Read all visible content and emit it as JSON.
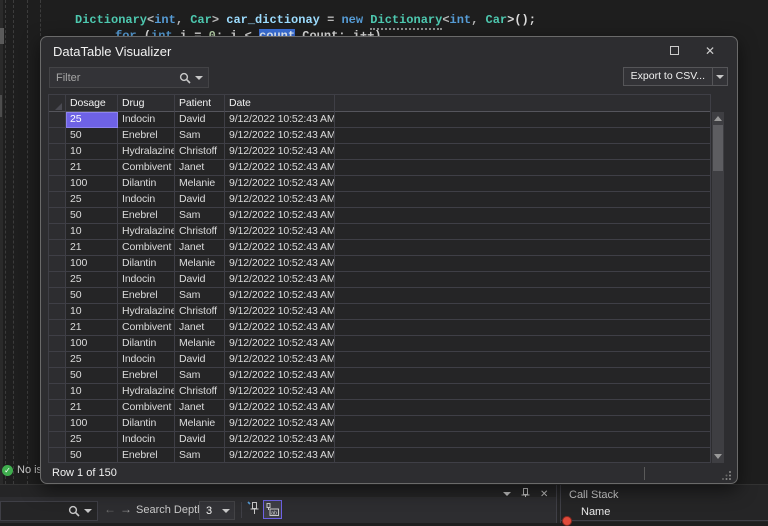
{
  "colors": {
    "editor_bg": "#1e1e1e",
    "dialog_bg": "#2d2d30",
    "grid_bg": "#252526",
    "gridline": "#3f3f46",
    "selected_cell": "#6e62e5",
    "selection_blue": "#3a6fd8",
    "type_teal": "#4EC9B0",
    "keyword_blue": "#569CD6",
    "variable_blue": "#9CDCFE",
    "success_green": "#3fae4e",
    "breakpoint_red": "#e04a3a",
    "toggle_accent": "#6e62e5"
  },
  "editor": {
    "code_line_1": [
      {
        "t": "Dictionary",
        "c": "type"
      },
      {
        "t": "<",
        "c": "op"
      },
      {
        "t": "int",
        "c": "kw"
      },
      {
        "t": ", ",
        "c": "op"
      },
      {
        "t": "Car",
        "c": "type"
      },
      {
        "t": "> ",
        "c": "op"
      },
      {
        "t": "car_dictionay",
        "c": "var"
      },
      {
        "t": " = ",
        "c": "op"
      },
      {
        "t": "new",
        "c": "kw"
      },
      {
        "t": " ",
        "c": "op"
      },
      {
        "t": "Dictionary",
        "c": "type",
        "dots": true
      },
      {
        "t": "<",
        "c": "op"
      },
      {
        "t": "int",
        "c": "kw"
      },
      {
        "t": ", ",
        "c": "op"
      },
      {
        "t": "Car",
        "c": "type"
      },
      {
        "t": ">();",
        "c": "plain"
      }
    ],
    "code_line_2": [
      {
        "t": "for",
        "c": "kw"
      },
      {
        "t": " (",
        "c": "plain"
      },
      {
        "t": "int",
        "c": "kw"
      },
      {
        "t": " i = ",
        "c": "plain"
      },
      {
        "t": "0",
        "c": "num"
      },
      {
        "t": "; i < ",
        "c": "plain"
      },
      {
        "t": "count",
        "c": "sel"
      },
      {
        "t": ".Count; i++)",
        "c": "plain"
      }
    ],
    "status_left": "No issu"
  },
  "dialog": {
    "title": "DataTable Visualizer",
    "maximize_glyph": "",
    "close_glyph": "✕",
    "filter_placeholder": "Filter",
    "export_button": "Export to CSV...",
    "status": "Row 1 of 150",
    "table": {
      "columns": [
        "Dosage",
        "Drug",
        "Patient",
        "Date"
      ],
      "selected_cell": {
        "row": 0,
        "col": 0
      },
      "rows": [
        [
          "25",
          "Indocin",
          "David",
          "9/12/2022 10:52:43 AM"
        ],
        [
          "50",
          "Enebrel",
          "Sam",
          "9/12/2022 10:52:43 AM"
        ],
        [
          "10",
          "Hydralazine",
          "Christoff",
          "9/12/2022 10:52:43 AM"
        ],
        [
          "21",
          "Combivent",
          "Janet",
          "9/12/2022 10:52:43 AM"
        ],
        [
          "100",
          "Dilantin",
          "Melanie",
          "9/12/2022 10:52:43 AM"
        ],
        [
          "25",
          "Indocin",
          "David",
          "9/12/2022 10:52:43 AM"
        ],
        [
          "50",
          "Enebrel",
          "Sam",
          "9/12/2022 10:52:43 AM"
        ],
        [
          "10",
          "Hydralazine",
          "Christoff",
          "9/12/2022 10:52:43 AM"
        ],
        [
          "21",
          "Combivent",
          "Janet",
          "9/12/2022 10:52:43 AM"
        ],
        [
          "100",
          "Dilantin",
          "Melanie",
          "9/12/2022 10:52:43 AM"
        ],
        [
          "25",
          "Indocin",
          "David",
          "9/12/2022 10:52:43 AM"
        ],
        [
          "50",
          "Enebrel",
          "Sam",
          "9/12/2022 10:52:43 AM"
        ],
        [
          "10",
          "Hydralazine",
          "Christoff",
          "9/12/2022 10:52:43 AM"
        ],
        [
          "21",
          "Combivent",
          "Janet",
          "9/12/2022 10:52:43 AM"
        ],
        [
          "100",
          "Dilantin",
          "Melanie",
          "9/12/2022 10:52:43 AM"
        ],
        [
          "25",
          "Indocin",
          "David",
          "9/12/2022 10:52:43 AM"
        ],
        [
          "50",
          "Enebrel",
          "Sam",
          "9/12/2022 10:52:43 AM"
        ],
        [
          "10",
          "Hydralazine",
          "Christoff",
          "9/12/2022 10:52:43 AM"
        ],
        [
          "21",
          "Combivent",
          "Janet",
          "9/12/2022 10:52:43 AM"
        ],
        [
          "100",
          "Dilantin",
          "Melanie",
          "9/12/2022 10:52:43 AM"
        ],
        [
          "25",
          "Indocin",
          "David",
          "9/12/2022 10:52:43 AM"
        ],
        [
          "50",
          "Enebrel",
          "Sam",
          "9/12/2022 10:52:43 AM"
        ]
      ]
    }
  },
  "bottom": {
    "search_depth_label": "Search Depth:",
    "search_depth_value": "3",
    "panel_title": "Call Stack",
    "name_column_header": "Name"
  }
}
